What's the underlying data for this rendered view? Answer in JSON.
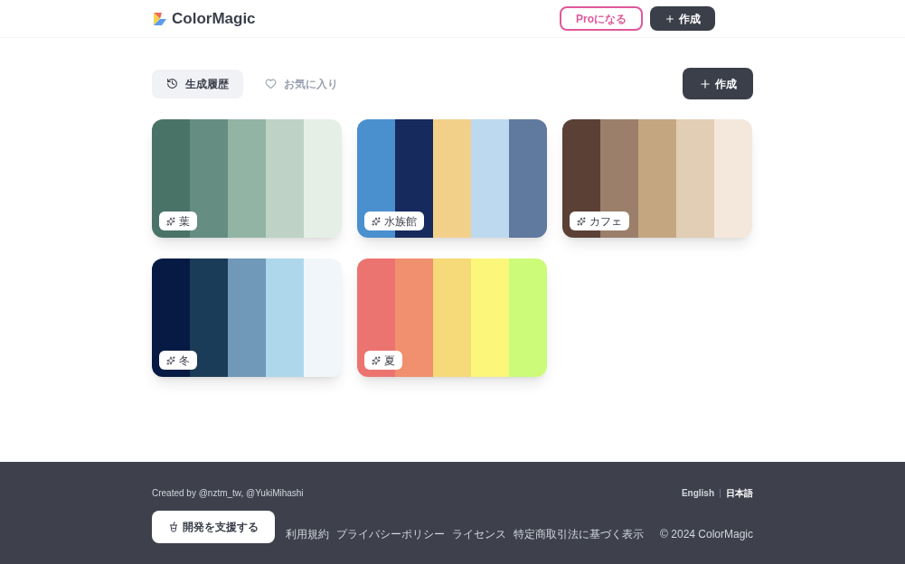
{
  "header": {
    "logo": "ColorMagic",
    "pro_button": "Proになる",
    "create_button": "作成"
  },
  "tabs": [
    {
      "label": "生成履歴",
      "kind": "history",
      "selected": true
    },
    {
      "label": "お気に入り",
      "kind": "favorite",
      "selected": false
    }
  ],
  "create_button": "作成",
  "palettes": [
    {
      "name": "葉",
      "swatches": [
        {
          "color": "#4a7368"
        },
        {
          "color": "#658d82"
        },
        {
          "color": "#92b4a4"
        },
        {
          "color": "#bed3c5"
        },
        {
          "color": "#e5efe6"
        }
      ]
    },
    {
      "name": "水族館",
      "swatches": [
        {
          "color": "#4a8fce"
        },
        {
          "color": "#172a5e"
        },
        {
          "color": "#f2d08a"
        },
        {
          "color": "#bcd9ef"
        },
        {
          "color": "#60799f"
        }
      ]
    },
    {
      "name": "カフェ",
      "swatches": [
        {
          "color": "#5b4036"
        },
        {
          "color": "#9c7f6a"
        },
        {
          "color": "#c4a681"
        },
        {
          "color": "#e2ceb4"
        },
        {
          "color": "#f4e8dc"
        }
      ]
    },
    {
      "name": "冬",
      "swatches": [
        {
          "color": "#071a44"
        },
        {
          "color": "#1a3c58"
        },
        {
          "color": "#7098b8"
        },
        {
          "color": "#aed7ec"
        },
        {
          "color": "#f0f6f9"
        }
      ]
    },
    {
      "name": "夏",
      "swatches": [
        {
          "color": "#ec7470"
        },
        {
          "color": "#f0906f"
        },
        {
          "color": "#f6d978"
        },
        {
          "color": "#fcf77b"
        },
        {
          "color": "#cbfb78"
        }
      ]
    }
  ],
  "footer": {
    "credit": "Created by @nztm_tw, @YukiMihashi",
    "languages": [
      {
        "label": "English",
        "selected": false
      },
      {
        "label": "日本語",
        "selected": true
      }
    ],
    "support_button": "開発を支援する",
    "links": [
      "利用規約",
      "プライバシーポリシー",
      "ライセンス",
      "特定商取引法に基づく表示"
    ],
    "copyright": "© 2024 ColorMagic"
  }
}
